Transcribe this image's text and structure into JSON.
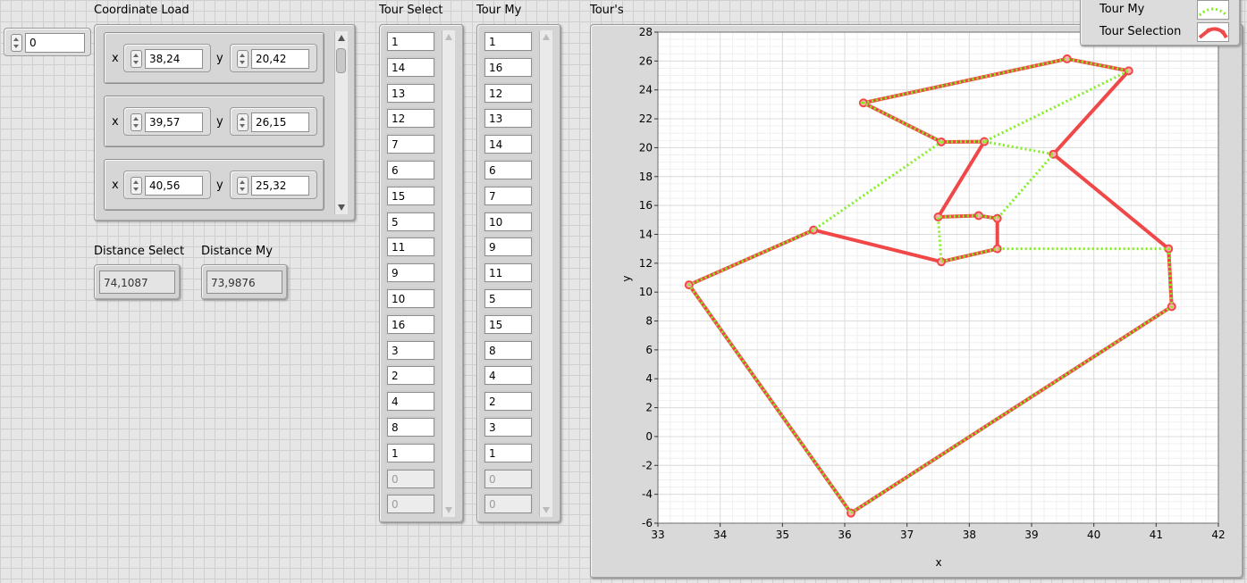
{
  "index_control": {
    "value": "0"
  },
  "coordinate_load": {
    "label": "Coordinate Load",
    "x_label": "x",
    "y_label": "y",
    "items": [
      {
        "x": "38,24",
        "y": "20,42"
      },
      {
        "x": "39,57",
        "y": "26,15"
      },
      {
        "x": "40,56",
        "y": "25,32"
      }
    ]
  },
  "distance_select": {
    "label": "Distance Select",
    "value": "74,1087"
  },
  "distance_my": {
    "label": "Distance My",
    "value": "73,9876"
  },
  "tour_select": {
    "label": "Tour Select",
    "values": [
      "1",
      "14",
      "13",
      "12",
      "7",
      "6",
      "15",
      "5",
      "11",
      "9",
      "10",
      "16",
      "3",
      "2",
      "4",
      "8",
      "1"
    ],
    "empty": [
      "0",
      "0"
    ]
  },
  "tour_my": {
    "label": "Tour My",
    "values": [
      "1",
      "16",
      "12",
      "13",
      "14",
      "6",
      "7",
      "10",
      "9",
      "11",
      "5",
      "15",
      "8",
      "4",
      "2",
      "3",
      "1"
    ],
    "empty": [
      "0",
      "0"
    ]
  },
  "graph": {
    "label": "Tour's",
    "legend": [
      {
        "name": "Tour My",
        "color": "#80f020"
      },
      {
        "name": "Tour Selection",
        "color": "#f04848"
      }
    ]
  },
  "chart_data": {
    "type": "line",
    "xlabel": "x",
    "ylabel": "y",
    "xlim": [
      33,
      42
    ],
    "ylim": [
      -6,
      28
    ],
    "x_ticks": [
      "33",
      "34",
      "35",
      "36",
      "37",
      "38",
      "39",
      "40",
      "41",
      "42"
    ],
    "y_ticks": [
      "-6",
      "-4",
      "-2",
      "0",
      "2",
      "4",
      "6",
      "8",
      "10",
      "12",
      "14",
      "16",
      "18",
      "20",
      "22",
      "24",
      "26",
      "28"
    ],
    "grid": true,
    "legend_position": "top-right",
    "series": [
      {
        "name": "Tour Selection",
        "color": "#f04848",
        "style": "solid",
        "points": [
          [
            38.24,
            20.42
          ],
          [
            37.55,
            20.4
          ],
          [
            36.3,
            23.1
          ],
          [
            39.57,
            26.15
          ],
          [
            40.56,
            25.32
          ],
          [
            39.35,
            19.55
          ],
          [
            41.2,
            13.0
          ],
          [
            41.25,
            9.0
          ],
          [
            36.1,
            -5.3
          ],
          [
            33.5,
            10.5
          ],
          [
            35.5,
            14.3
          ],
          [
            37.55,
            12.1
          ],
          [
            38.45,
            13.0
          ],
          [
            38.45,
            15.1
          ],
          [
            38.15,
            15.3
          ],
          [
            37.5,
            15.2
          ],
          [
            38.24,
            20.42
          ]
        ]
      },
      {
        "name": "Tour My",
        "color": "#80f020",
        "style": "dotted",
        "points": [
          [
            38.24,
            20.42
          ],
          [
            37.55,
            20.4
          ],
          [
            36.3,
            23.1
          ],
          [
            39.57,
            26.15
          ],
          [
            40.56,
            25.32
          ],
          [
            38.24,
            20.42
          ],
          [
            39.35,
            19.55
          ],
          [
            38.45,
            15.1
          ],
          [
            38.15,
            15.3
          ],
          [
            37.5,
            15.2
          ],
          [
            37.55,
            12.1
          ],
          [
            38.45,
            13.0
          ],
          [
            41.2,
            13.0
          ],
          [
            41.25,
            9.0
          ],
          [
            36.1,
            -5.3
          ],
          [
            33.5,
            10.5
          ],
          [
            35.5,
            14.3
          ],
          [
            37.55,
            20.4
          ]
        ]
      }
    ]
  }
}
